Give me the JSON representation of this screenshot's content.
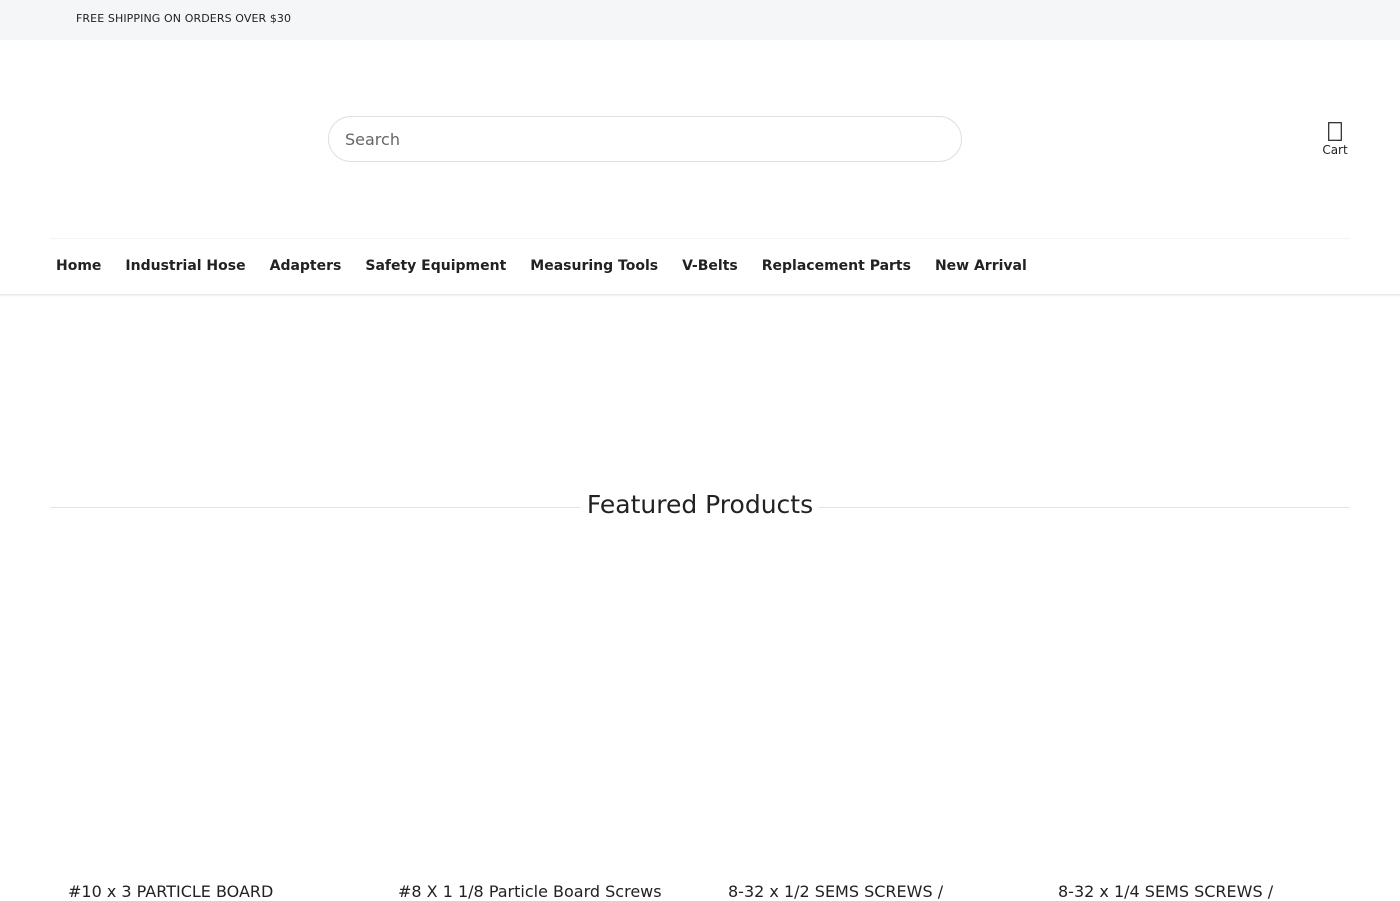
{
  "announcement": "FREE SHIPPING ON ORDERS OVER $30",
  "search": {
    "placeholder": "Search"
  },
  "cart": {
    "label": "Cart"
  },
  "nav": {
    "items": [
      "Home",
      "Industrial Hose",
      "Adapters",
      "Safety Equipment",
      "Measuring Tools",
      "V-Belts",
      "Replacement Parts",
      "New Arrival"
    ]
  },
  "featured": {
    "title": "Featured Products"
  },
  "products": [
    {
      "title": "#10 x 3 PARTICLE BOARD"
    },
    {
      "title": "#8 X 1 1/8 Particle Board Screws"
    },
    {
      "title": "8-32 x 1/2 SEMS SCREWS /"
    },
    {
      "title": "8-32 x 1/4 SEMS SCREWS /"
    }
  ]
}
